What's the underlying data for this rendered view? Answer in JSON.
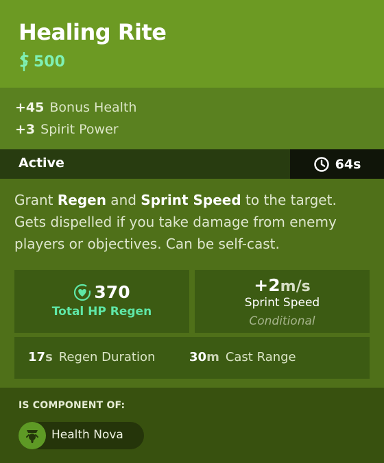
{
  "item": {
    "title": "Healing Rite",
    "cost": "500",
    "colors": {
      "header": "#6c9a23",
      "body": "#4f7019",
      "cost": "#7ff0b4",
      "regen_label": "#5fe7a7"
    }
  },
  "stats": [
    {
      "value": "+45",
      "label": "Bonus Health"
    },
    {
      "value": "+3",
      "label": "Spirit Power"
    }
  ],
  "active": {
    "label": "Active",
    "cooldown": "64s"
  },
  "description": {
    "p1": "Grant ",
    "k1": "Regen",
    "p2": " and ",
    "k2": "Sprint Speed",
    "p3": " to the target. Gets dispelled if you take damage from enemy players or objectives. Can be self-cast."
  },
  "hp_regen": {
    "value": "370",
    "label": "Total HP Regen"
  },
  "sprint": {
    "value": "+2",
    "unit": "m/s",
    "label": "Sprint Speed",
    "condition": "Conditional"
  },
  "duration": {
    "value": "17",
    "unit": "s",
    "label": "Regen Duration"
  },
  "cast_range": {
    "value": "30",
    "unit": "m",
    "label": "Cast Range"
  },
  "component": {
    "heading": "IS COMPONENT OF:",
    "items": [
      {
        "name": "Health Nova",
        "icon": "health-nova-icon"
      }
    ]
  }
}
